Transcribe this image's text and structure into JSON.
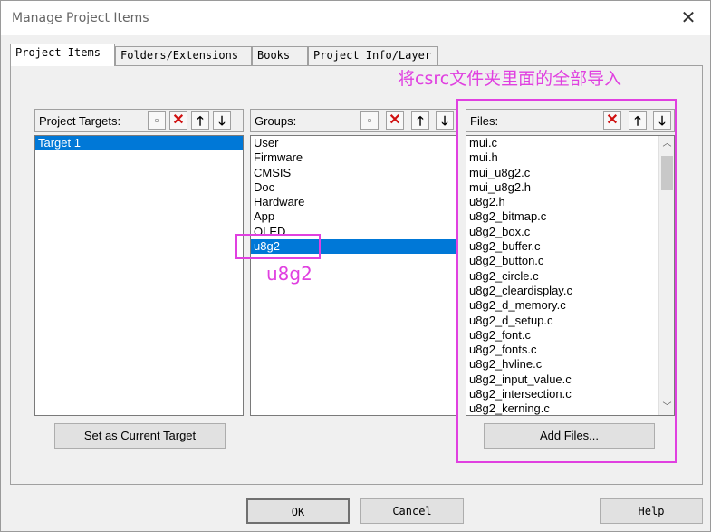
{
  "window": {
    "title": "Manage Project Items",
    "close_glyph": "✕"
  },
  "tabs": [
    {
      "label": "Project Items",
      "active": true
    },
    {
      "label": "Folders/Extensions",
      "active": false
    },
    {
      "label": "Books",
      "active": false
    },
    {
      "label": "Project Info/Layer",
      "active": false
    }
  ],
  "annotations": {
    "header_note": "将csrc文件夹里面的全部导入",
    "group_note": "u8g2",
    "color": "#e040e0"
  },
  "targets": {
    "label": "Project Targets:",
    "items": [
      "Target 1"
    ],
    "selected_index": 0,
    "set_current_label": "Set as Current Target"
  },
  "groups": {
    "label": "Groups:",
    "items": [
      "User",
      "Firmware",
      "CMSIS",
      "Doc",
      "Hardware",
      "App",
      "OLED",
      "u8g2"
    ],
    "selected_index": 7
  },
  "files": {
    "label": "Files:",
    "items": [
      "mui.c",
      "mui.h",
      "mui_u8g2.c",
      "mui_u8g2.h",
      "u8g2.h",
      "u8g2_bitmap.c",
      "u8g2_box.c",
      "u8g2_buffer.c",
      "u8g2_button.c",
      "u8g2_circle.c",
      "u8g2_cleardisplay.c",
      "u8g2_d_memory.c",
      "u8g2_d_setup.c",
      "u8g2_font.c",
      "u8g2_fonts.c",
      "u8g2_hvline.c",
      "u8g2_input_value.c",
      "u8g2_intersection.c",
      "u8g2_kerning.c"
    ],
    "add_files_label": "Add Files..."
  },
  "toolbar_icons": {
    "new": "new-item-icon",
    "delete": "delete-icon",
    "up": "move-up-icon",
    "down": "move-down-icon"
  },
  "buttons": {
    "ok": "OK",
    "cancel": "Cancel",
    "help": "Help"
  },
  "colors": {
    "selection": "#0078d7",
    "delete": "#d01010",
    "annotation": "#e040e0"
  }
}
